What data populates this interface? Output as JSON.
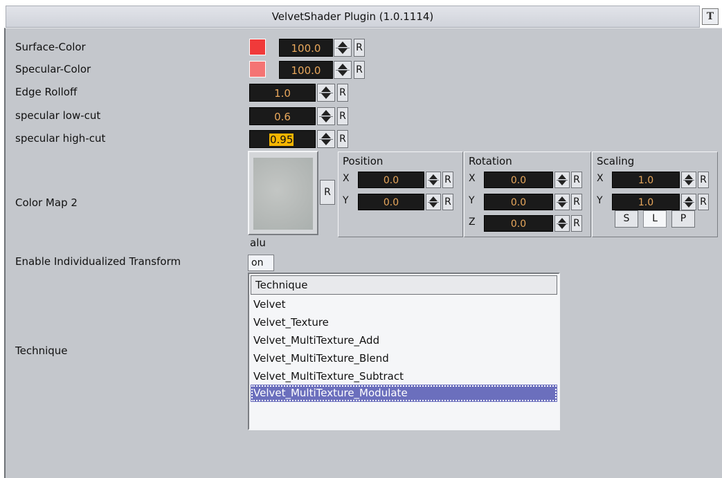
{
  "window": {
    "title": "VelvetShader Plugin (1.0.1114)",
    "icon": "plugin-window-icon"
  },
  "labels": {
    "surface_color": "Surface-Color",
    "specular_color": "Specular-Color",
    "edge_rolloff": "Edge Rolloff",
    "specular_low_cut": "specular low-cut",
    "specular_high_cut": "specular high-cut",
    "color_map": "Color Map 2",
    "enable_transform": "Enable Individualized Transform",
    "technique": "Technique"
  },
  "colors": {
    "surface": "#f03a3a",
    "specular": "#f47474",
    "value_text": "#e9a85c",
    "selection": "#6b6fbd"
  },
  "values": {
    "surface_color": "100.0",
    "specular_color": "100.0",
    "edge_rolloff": "1.0",
    "specular_low_cut": "0.6",
    "specular_high_cut": "0.95"
  },
  "reset_label": "R",
  "texture": {
    "name": "alu"
  },
  "position": {
    "title": "Position",
    "x_label": "X",
    "y_label": "Y",
    "x": "0.0",
    "y": "0.0"
  },
  "rotation": {
    "title": "Rotation",
    "x_label": "X",
    "y_label": "Y",
    "z_label": "Z",
    "x": "0.0",
    "y": "0.0",
    "z": "0.0"
  },
  "scaling": {
    "title": "Scaling",
    "x_label": "X",
    "y_label": "Y",
    "x": "1.0",
    "y": "1.0",
    "s_label": "S",
    "l_label": "L",
    "p_label": "P",
    "active": "L"
  },
  "enable_transform": {
    "value": "on"
  },
  "technique_list": {
    "header": "Technique",
    "items": [
      "Velvet",
      "Velvet_Texture",
      "Velvet_MultiTexture_Add",
      "Velvet_MultiTexture_Blend",
      "Velvet_MultiTexture_Subtract",
      "Velvet_MultiTexture_Modulate"
    ],
    "selected": "Velvet_MultiTexture_Modulate"
  }
}
